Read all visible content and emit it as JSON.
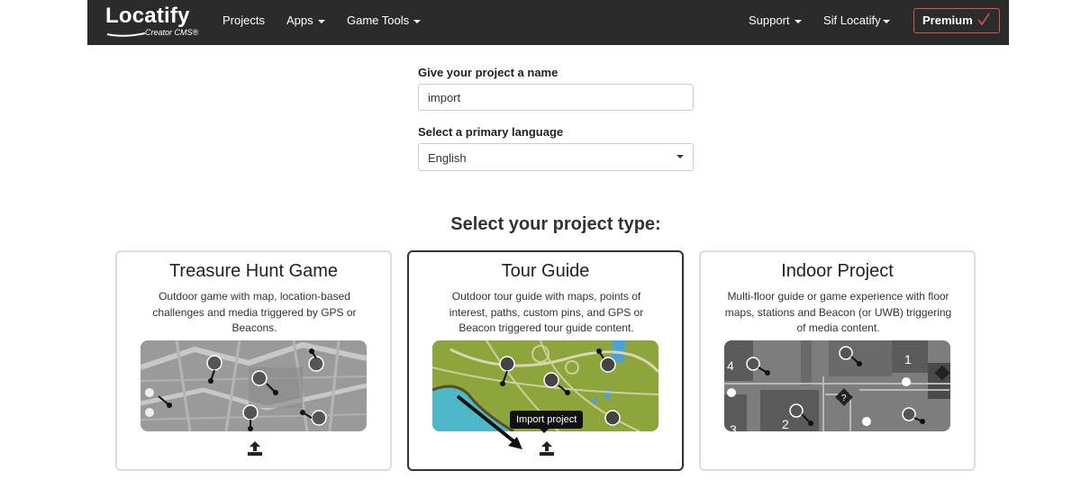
{
  "brand": {
    "name": "Locatify",
    "subtitle": "Creator CMS®"
  },
  "nav": {
    "projects": "Projects",
    "apps": "Apps",
    "game_tools": "Game Tools",
    "support": "Support",
    "user": "Sif Locatify",
    "premium": "Premium"
  },
  "form": {
    "name_label": "Give your project a name",
    "name_value": "import",
    "language_label": "Select a primary language",
    "language_value": "English"
  },
  "section_title": "Select your project type:",
  "cards": [
    {
      "title": "Treasure Hunt Game",
      "description": "Outdoor game with map, location-based challenges and media triggered by GPS or Beacons.",
      "selected": false
    },
    {
      "title": "Tour Guide",
      "description": "Outdoor tour guide with maps, points of interest, paths, custom pins, and GPS or Beacon triggered tour guide content.",
      "selected": true
    },
    {
      "title": "Indoor Project",
      "description": "Multi-floor guide or game experience with floor maps, stations and Beacon (or UWB) triggering of media content.",
      "selected": false
    }
  ],
  "tooltip": "Import project",
  "icons": {
    "upload": "upload-icon",
    "caret": "caret-down-icon",
    "check": "check-icon"
  },
  "colors": {
    "navbar": "#2b2b2b",
    "premium_border": "#d9534f",
    "selected_border": "#333333",
    "card_border": "#dddddd"
  },
  "indoor_map_numbers": [
    "4",
    "1",
    "2",
    "3"
  ]
}
